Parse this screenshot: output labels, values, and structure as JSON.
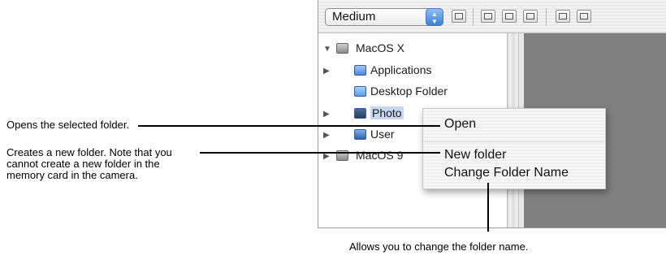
{
  "toolbar": {
    "size_select_value": "Medium",
    "icons": [
      "fit-icon",
      "import-icon",
      "export-icon",
      "window-icon",
      "copy-icon",
      "copy2-icon"
    ]
  },
  "tree": {
    "items": [
      {
        "label": "MacOS X",
        "icon": "hard-disk-icon",
        "expanded": true
      },
      {
        "label": "Applications",
        "icon": "applications-folder-icon"
      },
      {
        "label": "Desktop Folder",
        "icon": "folder-icon"
      },
      {
        "label": "Photo",
        "icon": "folder-icon",
        "selected": true
      },
      {
        "label": "User",
        "icon": "user-folder-icon"
      },
      {
        "label": "MacOS 9",
        "icon": "hard-disk-icon"
      }
    ]
  },
  "context_menu": {
    "items": [
      "Open",
      "New folder",
      "Change Folder Name"
    ]
  },
  "callouts": {
    "open": "Opens the selected folder.",
    "new_folder_line1": "Creates a new folder. Note that you",
    "new_folder_line2": "cannot create a new folder in the",
    "new_folder_line3": "memory card in the camera.",
    "rename": "Allows you to change the folder name."
  },
  "colors": {
    "accent": "#3a7fd6",
    "preview_bg": "#808080"
  }
}
